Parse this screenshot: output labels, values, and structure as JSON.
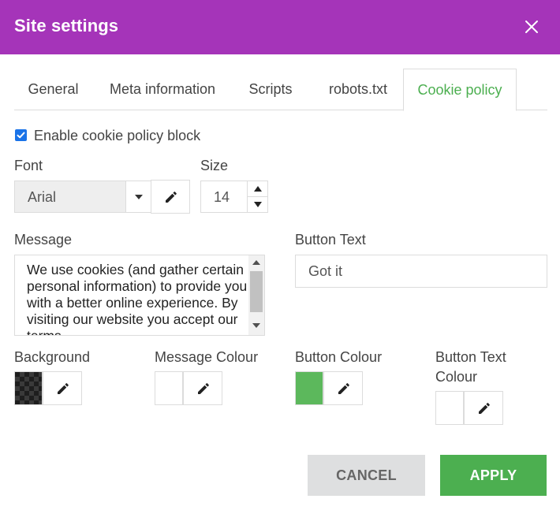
{
  "dialog": {
    "title": "Site settings"
  },
  "tabs": [
    {
      "label": "General"
    },
    {
      "label": "Meta information"
    },
    {
      "label": "Scripts"
    },
    {
      "label": "robots.txt"
    },
    {
      "label": "Cookie policy",
      "active": true
    }
  ],
  "form": {
    "enable_checkbox": {
      "label": "Enable cookie policy block",
      "checked": true
    },
    "font": {
      "label": "Font",
      "value": "Arial"
    },
    "size": {
      "label": "Size",
      "value": "14"
    },
    "message": {
      "label": "Message",
      "value": "We use cookies (and gather certain personal information) to provide you with a better online experience. By visiting our website you accept our terms"
    },
    "button_text": {
      "label": "Button Text",
      "value": "Got it"
    },
    "background": {
      "label": "Background",
      "color": "#1e1e1e"
    },
    "message_colour": {
      "label": "Message Colour",
      "color": "#ffffff"
    },
    "button_colour": {
      "label": "Button Colour",
      "color": "#5cb85c"
    },
    "button_text_colour": {
      "label_line1": "Button Text",
      "label_line2": "Colour",
      "color": "#ffffff"
    }
  },
  "footer": {
    "cancel_label": "CANCEL",
    "apply_label": "APPLY"
  },
  "icons": {
    "close": "close-icon",
    "edit": "pencil-icon",
    "dropdown": "caret-down-icon",
    "check": "check-icon"
  },
  "colors": {
    "header": "#a534b9",
    "accent": "#4caf50",
    "checkbox": "#1a73e8"
  }
}
